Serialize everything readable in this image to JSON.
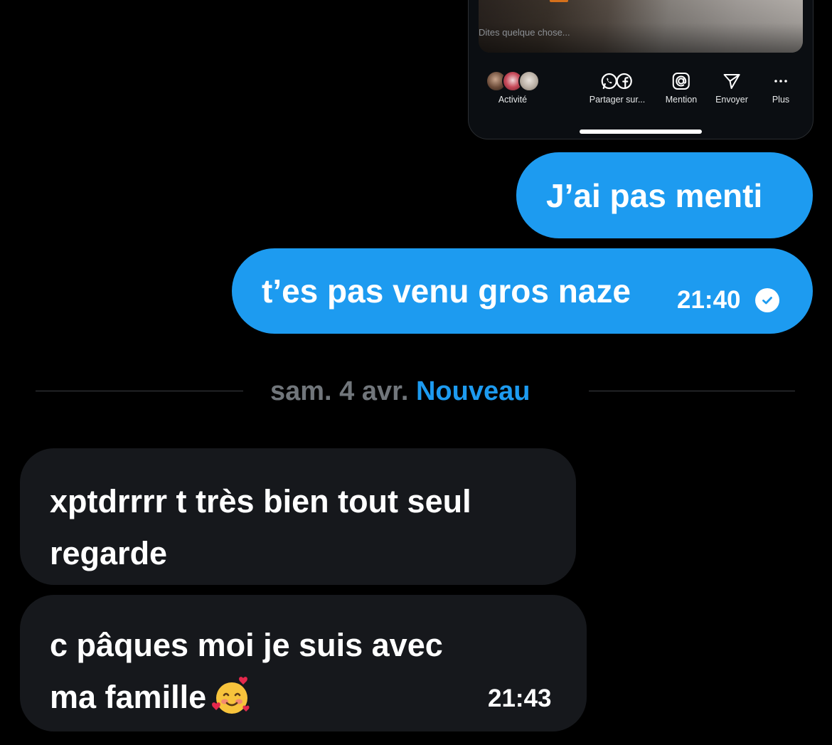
{
  "shared_post": {
    "input_placeholder": "Dites quelque chose...",
    "actions": [
      {
        "label": "Activité",
        "icon": "avatars-stack"
      },
      {
        "label": "Partager sur...",
        "icon": "whatsapp-facebook-icon"
      },
      {
        "label": "Mention",
        "icon": "at-sign-icon"
      },
      {
        "label": "Envoyer",
        "icon": "send-paper-plane-icon"
      },
      {
        "label": "Plus",
        "icon": "more-dots-icon"
      }
    ]
  },
  "messages": [
    {
      "direction": "outgoing",
      "text": "J’ai pas menti"
    },
    {
      "direction": "outgoing",
      "text": "t’es pas venu gros naze",
      "time": "21:40",
      "status": "read-check"
    },
    {
      "direction": "incoming",
      "text": "xptdrrrr t très bien tout seul regarde"
    },
    {
      "direction": "incoming",
      "text": "c pâques moi je suis avec ma famille",
      "emoji": "smiling-face-with-hearts",
      "time": "21:43"
    }
  ],
  "separator": {
    "date": "sam. 4 avr.",
    "new_label": "Nouveau"
  },
  "colors": {
    "background": "#000000",
    "outgoing_bubble": "#1d9bf0",
    "incoming_bubble": "#16181c",
    "accent": "#1d9bf0",
    "muted_text": "#71767b"
  }
}
